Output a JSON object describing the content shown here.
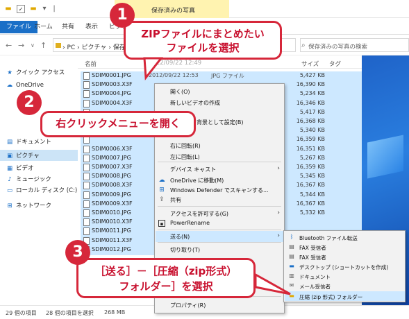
{
  "window": {
    "title": "保存済みの写真"
  },
  "ribbon": {
    "tabs": [
      "ファイル",
      "ホーム",
      "共有",
      "表示",
      "ピクチャ"
    ]
  },
  "address": {
    "path": "› PC › ピクチャ › 保存済みの写真",
    "search_placeholder": "保存済みの写真の検索"
  },
  "navpane": {
    "items": [
      {
        "label": "クイック アクセス",
        "icon": "star-icon"
      },
      {
        "label": "OneDrive",
        "icon": "cloud-icon"
      },
      {
        "label": "ドキュメント",
        "icon": "document-icon"
      },
      {
        "label": "ピクチャ",
        "icon": "picture-icon"
      },
      {
        "label": "ビデオ",
        "icon": "video-icon"
      },
      {
        "label": "ミュージック",
        "icon": "music-icon"
      },
      {
        "label": "ローカル ディスク (C:)",
        "icon": "drive-icon"
      },
      {
        "label": "ネットワーク",
        "icon": "network-icon"
      }
    ]
  },
  "filelist": {
    "columns": [
      "名前",
      "サイズ",
      "タグ"
    ],
    "header_date_fragment": "2012/09/22 12:49",
    "rows": [
      {
        "name": "SDIM0001.JPG",
        "date": "2012/09/22 12:53",
        "type": "JPG ファイル",
        "size": "5,427 KB"
      },
      {
        "name": "SDIM0003.X3F",
        "date": "",
        "type": "",
        "size": "16,390 KB"
      },
      {
        "name": "SDIM0004.JPG",
        "date": "",
        "type": "",
        "size": "5,234 KB"
      },
      {
        "name": "SDIM0004.X3F",
        "date": "",
        "type": "",
        "size": "16,346 KB"
      },
      {
        "name": "",
        "date": "",
        "type": "",
        "size": "5,417 KB"
      },
      {
        "name": "",
        "date": "",
        "type": "",
        "size": "16,368 KB"
      },
      {
        "name": "",
        "date": "",
        "type": "",
        "size": "5,340 KB"
      },
      {
        "name": "",
        "date": "",
        "type": "",
        "size": "16,359 KB"
      },
      {
        "name": "SDIM0006.X3F",
        "date": "",
        "type": "",
        "size": "16,351 KB"
      },
      {
        "name": "SDIM0007.JPG",
        "date": "",
        "type": "",
        "size": "5,267 KB"
      },
      {
        "name": "SDIM0007.X3F",
        "date": "",
        "type": "",
        "size": "16,359 KB"
      },
      {
        "name": "SDIM0008.JPG",
        "date": "",
        "type": "",
        "size": "5,345 KB"
      },
      {
        "name": "SDIM0008.X3F",
        "date": "",
        "type": "",
        "size": "16,367 KB"
      },
      {
        "name": "SDIM0009.JPG",
        "date": "",
        "type": "",
        "size": "5,344 KB"
      },
      {
        "name": "SDIM0009.X3F",
        "date": "",
        "type": "",
        "size": "16,367 KB"
      },
      {
        "name": "SDIM0010.JPG",
        "date": "",
        "type": "",
        "size": "5,332 KB"
      },
      {
        "name": "SDIM0010.X3F",
        "date": "",
        "type": "",
        "size": ""
      },
      {
        "name": "SDIM0011.JPG",
        "date": "",
        "type": "",
        "size": ""
      },
      {
        "name": "SDIM0011.X3F",
        "date": "",
        "type": "",
        "size": ""
      },
      {
        "name": "SDIM0012.JPG",
        "date": "",
        "type": "",
        "size": ""
      }
    ]
  },
  "context_menu": {
    "items": [
      {
        "label": "開く(O)",
        "icon": ""
      },
      {
        "label": "新しいビデオの作成",
        "icon": ""
      },
      {
        "label": "背景として設定(B)",
        "icon": ""
      },
      {
        "label": "右に回転(R)",
        "icon": ""
      },
      {
        "label": "左に回転(L)",
        "icon": ""
      },
      {
        "label": "デバイス キャスト",
        "icon": ""
      },
      {
        "label": "OneDrive に移動(M)",
        "icon": "cloud-icon"
      },
      {
        "label": "Windows Defender でスキャンする...",
        "icon": "shield-icon"
      },
      {
        "label": "共有",
        "icon": "share-icon"
      },
      {
        "label": "アクセスを許可する(G)",
        "icon": ""
      },
      {
        "label": "PowerRename",
        "icon": "rename-icon"
      },
      {
        "label": "送る(N)",
        "icon": ""
      },
      {
        "label": "切り取り(T)",
        "icon": ""
      },
      {
        "label": "プロパティ(R)",
        "icon": ""
      }
    ]
  },
  "submenu": {
    "items": [
      {
        "label": "Bluetooth ファイル転送",
        "icon": "bluetooth-icon"
      },
      {
        "label": "FAX 受信者",
        "icon": "fax-icon"
      },
      {
        "label": "FAX 受信者",
        "icon": "fax-icon"
      },
      {
        "label": "デスクトップ (ショートカットを作成)",
        "icon": "desktop-icon"
      },
      {
        "label": "ドキュメント",
        "icon": "document-icon"
      },
      {
        "label": "メール受信者",
        "icon": "mail-icon"
      },
      {
        "label": "圧縮 (zip 形式) フォルダー",
        "icon": "zip-folder-icon"
      }
    ]
  },
  "status": {
    "count": "29 個の項目",
    "selected": "28 個の項目を選択",
    "size": "268 MB"
  },
  "callouts": [
    {
      "number": "1",
      "line1": "ZIPファイルにまとめたい",
      "line2": "ファイルを選択"
    },
    {
      "number": "2",
      "line1": "右クリックメニューを開く",
      "line2": ""
    },
    {
      "number": "3",
      "line1": "［送る］－［圧縮（zip形式）",
      "line2": "フォルダー］を選択"
    }
  ],
  "colors": {
    "accent": "#1a6fc7",
    "callout": "#d6273a",
    "selection": "#cde8ff"
  }
}
